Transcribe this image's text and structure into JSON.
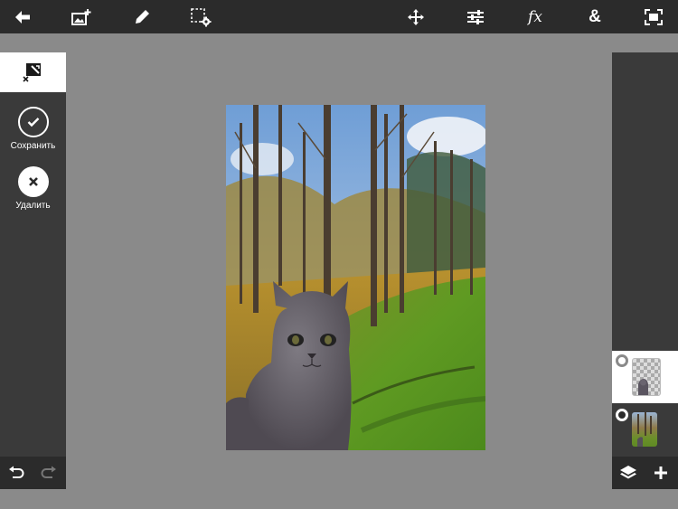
{
  "app": {
    "accent": "#ffffff",
    "toolbar_bg": "#2b2b2b",
    "panel_bg": "#3a3a3a",
    "workspace_bg": "#8a8a8a"
  },
  "toolbar": {
    "left_icons": [
      "back-arrow-icon",
      "add-image-icon",
      "brush-icon",
      "selection-settings-icon"
    ],
    "right_icons": [
      "move-icon",
      "adjustments-icon",
      "fx-icon",
      "blend-ampersand-icon",
      "fit-screen-icon"
    ],
    "fx_label": "fx",
    "amp_label": "&"
  },
  "left_panel": {
    "tool_icon": "selection-erase-icon",
    "save_label": "Сохранить",
    "delete_label": "Удалить"
  },
  "right_panel": {
    "layers": [
      {
        "name": "cat-layer",
        "active": true
      },
      {
        "name": "forest-layer",
        "active": false
      }
    ]
  },
  "canvas": {
    "content": "photo"
  }
}
